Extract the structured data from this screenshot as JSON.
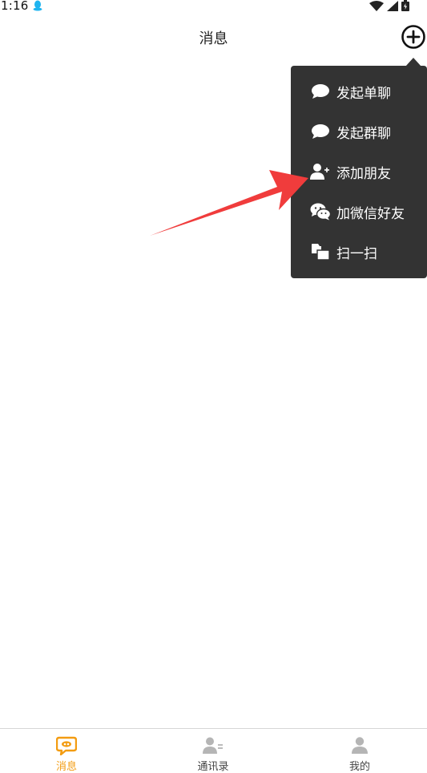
{
  "status_bar": {
    "time": "1:16",
    "app_icon": "qq-penguin-icon",
    "app_icon_color": "#1eb4f0",
    "wifi_icon": "wifi-icon",
    "signal_icon": "signal-icon",
    "battery_icon": "battery-icon"
  },
  "header": {
    "title": "消息",
    "action_icon": "add-circle-icon"
  },
  "popup_menu": {
    "background": "#333333",
    "items": [
      {
        "label": "发起单聊",
        "icon": "chat-bubble-icon"
      },
      {
        "label": "发起群聊",
        "icon": "chat-bubble-icon"
      },
      {
        "label": "添加朋友",
        "icon": "add-friend-icon"
      },
      {
        "label": "加微信好友",
        "icon": "wechat-icon"
      },
      {
        "label": "扫一扫",
        "icon": "scan-icon"
      }
    ]
  },
  "annotation": {
    "arrow_color": "#f03c3c",
    "points_to": "添加朋友"
  },
  "tab_bar": {
    "active_color": "#f39c12",
    "inactive_color": "#b5b5b5",
    "tabs": [
      {
        "label": "消息",
        "icon": "message-icon",
        "active": true
      },
      {
        "label": "通讯录",
        "icon": "contacts-icon",
        "active": false
      },
      {
        "label": "我的",
        "icon": "profile-icon",
        "active": false
      }
    ]
  }
}
